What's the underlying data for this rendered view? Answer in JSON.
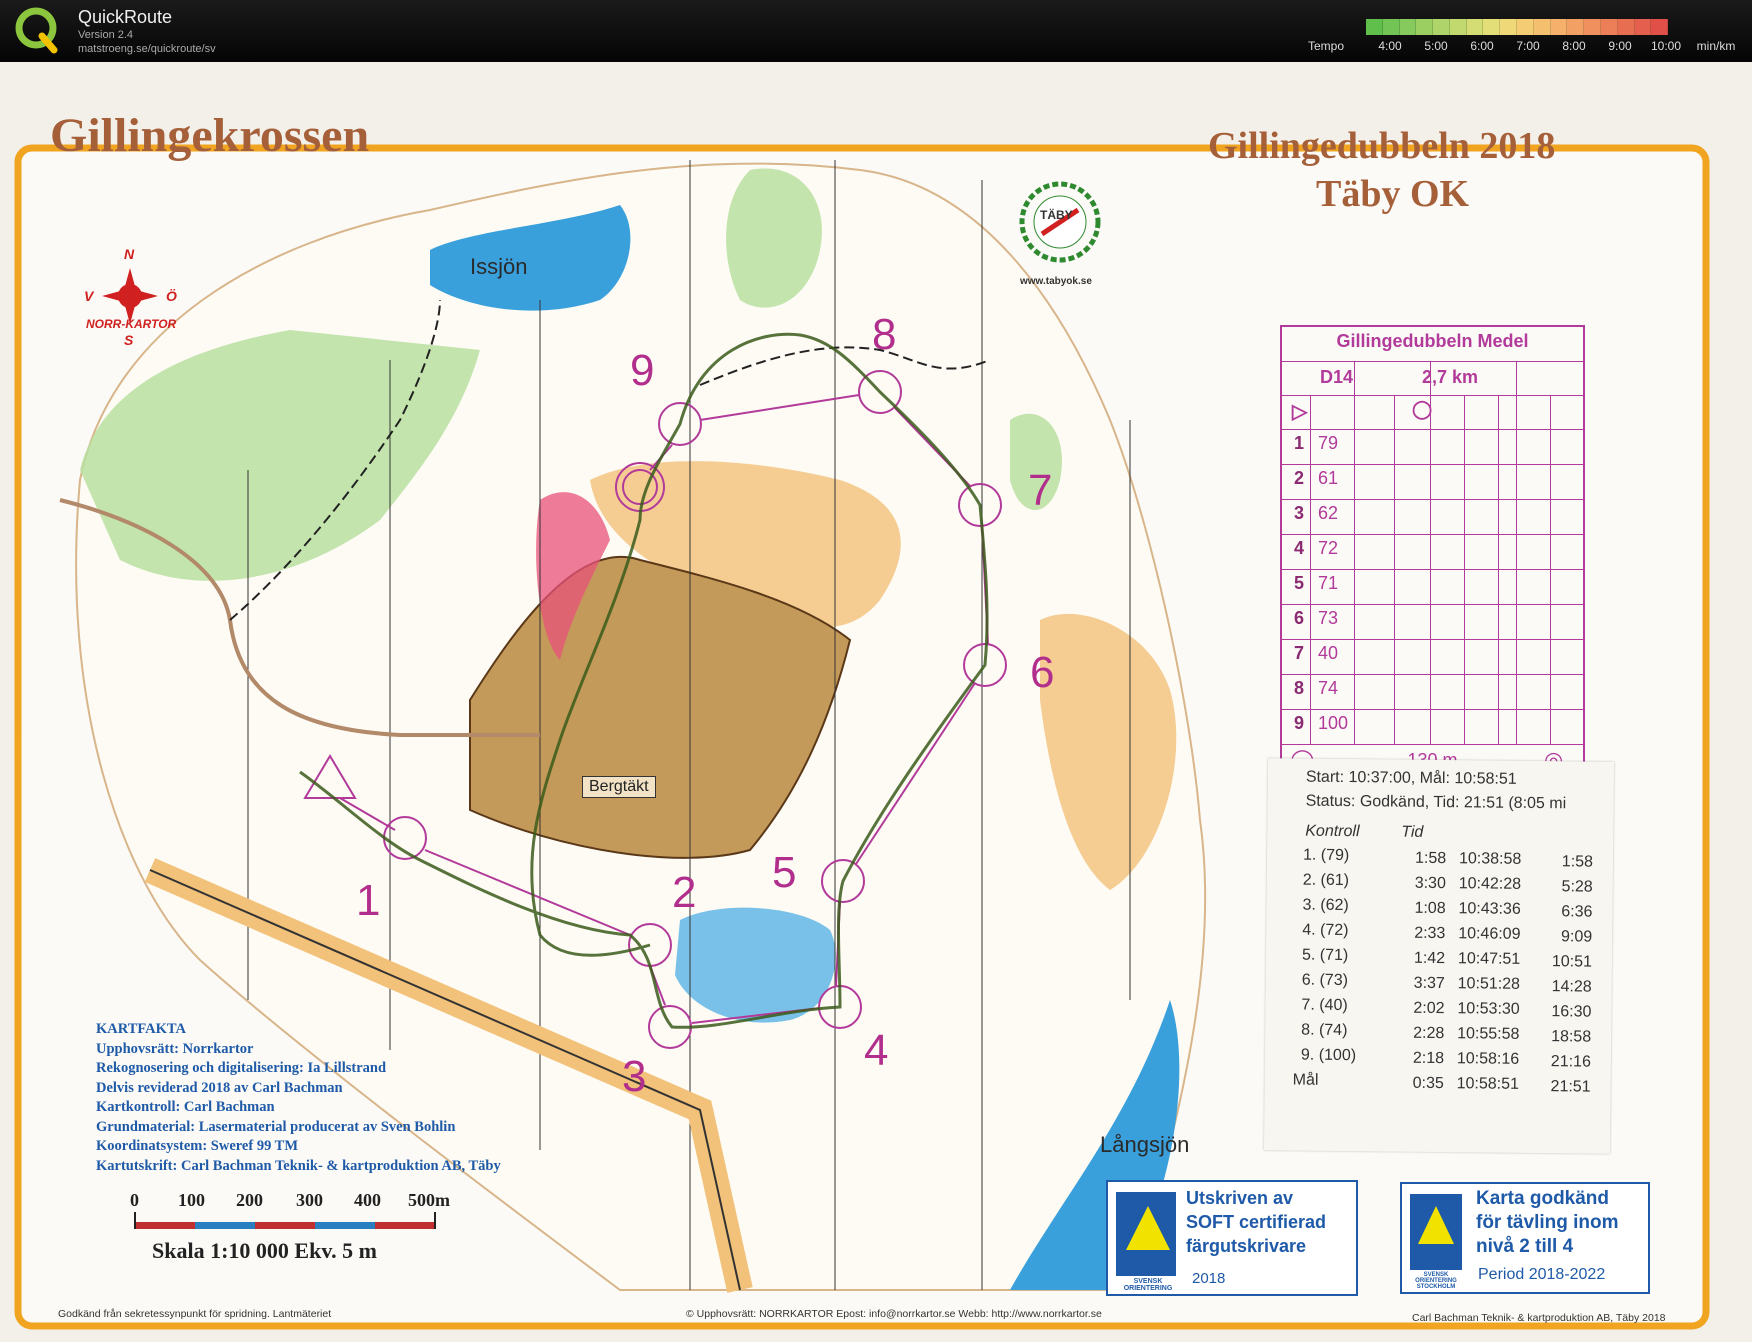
{
  "app": {
    "title": "QuickRoute",
    "version": "Version 2.4",
    "url": "matstroeng.se/quickroute/sv"
  },
  "tempo": {
    "label": "Tempo",
    "ticks": [
      "4:00",
      "5:00",
      "6:00",
      "7:00",
      "8:00",
      "9:00",
      "10:00"
    ],
    "unit": "min/km"
  },
  "map": {
    "title": "Gillingekrossen",
    "event_title": "Gillingedubbeln 2018",
    "club": "Täby OK",
    "club_logo_text": "TÄBY",
    "club_url": "www.tabyok.se",
    "compass": {
      "n": "N",
      "s": "S",
      "w": "V",
      "e": "Ö",
      "brand": "NORR-KARTOR"
    },
    "labels": {
      "lake1": "Issjön",
      "lake2": "Långsjön",
      "quarry": "Bergtäkt"
    },
    "control_numbers": [
      "1",
      "2",
      "3",
      "4",
      "5",
      "6",
      "7",
      "8",
      "9"
    ],
    "kartfakta": [
      "KARTFAKTA",
      "Upphovsrätt: Norrkartor",
      "Rekognosering och digitalisering: Ia Lillstrand",
      "Delvis reviderad 2018 av Carl Bachman",
      "Kartkontroll: Carl Bachman",
      "Grundmaterial: Lasermaterial producerat av Sven Bohlin",
      "Koordinatsystem: Sweref 99 TM",
      "Kartutskrift: Carl Bachman Teknik- & kartproduktion AB, Täby"
    ],
    "scale_ticks": [
      "0",
      "100",
      "200",
      "300",
      "400",
      "500m"
    ],
    "scale_text": "Skala 1:10 000  Ekv. 5 m",
    "footer_left": "Godkänd från sekretessynpunkt  för spridning. Lantmäteriet",
    "footer_mid": "©  Upphovsrätt: NORRKARTOR  Epost: info@norrkartor.se    Webb: http://www.norrkartor.se",
    "footer_right": "Carl Bachman Teknik- & kartproduktion AB, Täby 2018",
    "soft_badge": {
      "lines": [
        "Utskriven av",
        "SOFT certifierad",
        "färgutskrivare"
      ],
      "year": "2018",
      "org": "SVENSK ORIENTERING"
    },
    "approved_badge": {
      "lines": [
        "Karta godkänd",
        "för tävling inom",
        "nivå 2 till 4"
      ],
      "period": "Period 2018-2022",
      "org": "SVENSK ORIENTERING STOCKHOLM"
    }
  },
  "control_description": {
    "title": "Gillingedubbeln Medel",
    "class": "D14",
    "length": "2,7 km",
    "rows": [
      {
        "n": "1",
        "code": "79"
      },
      {
        "n": "2",
        "code": "61"
      },
      {
        "n": "3",
        "code": "62"
      },
      {
        "n": "4",
        "code": "72"
      },
      {
        "n": "5",
        "code": "71"
      },
      {
        "n": "6",
        "code": "73"
      },
      {
        "n": "7",
        "code": "40"
      },
      {
        "n": "8",
        "code": "74"
      },
      {
        "n": "9",
        "code": "100"
      }
    ],
    "finish_distance": "130 m"
  },
  "receipt": {
    "start_line": "Start: 10:37:00, Mål: 10:58:51",
    "status_line": "Status: Godkänd, Tid: 21:51 (8:05 mi",
    "col_control": "Kontroll",
    "col_time": "Tid",
    "rows": [
      {
        "ctl": "1.   (79)",
        "split": "1:58",
        "clock": "10:38:58",
        "total": "1:58"
      },
      {
        "ctl": "2.   (61)",
        "split": "3:30",
        "clock": "10:42:28",
        "total": "5:28"
      },
      {
        "ctl": "3.   (62)",
        "split": "1:08",
        "clock": "10:43:36",
        "total": "6:36"
      },
      {
        "ctl": "4.   (72)",
        "split": "2:33",
        "clock": "10:46:09",
        "total": "9:09"
      },
      {
        "ctl": "5.   (71)",
        "split": "1:42",
        "clock": "10:47:51",
        "total": "10:51"
      },
      {
        "ctl": "6.   (73)",
        "split": "3:37",
        "clock": "10:51:28",
        "total": "14:28"
      },
      {
        "ctl": "7.   (40)",
        "split": "2:02",
        "clock": "10:53:30",
        "total": "16:30"
      },
      {
        "ctl": "8.   (74)",
        "split": "2:28",
        "clock": "10:55:58",
        "total": "18:58"
      },
      {
        "ctl": "9.   (100)",
        "split": "2:18",
        "clock": "10:58:16",
        "total": "21:16"
      },
      {
        "ctl": "Mål",
        "split": "0:35",
        "clock": "10:58:51",
        "total": "21:51"
      }
    ]
  }
}
